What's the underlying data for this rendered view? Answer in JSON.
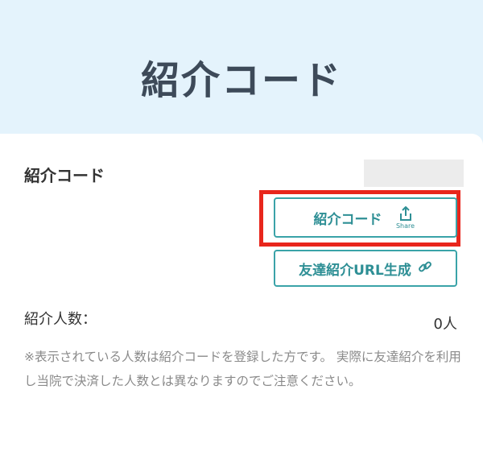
{
  "header": {
    "title": "紹介コード"
  },
  "code_section": {
    "label": "紹介コード",
    "value": ""
  },
  "buttons": {
    "share": {
      "label": "紹介コード",
      "icon": "share-icon",
      "caption": "Share"
    },
    "url": {
      "label": "友達紹介URL生成",
      "icon": "link-icon"
    }
  },
  "stats": {
    "count_label": "紹介人数：",
    "count_value": "0人"
  },
  "notice": "※表示されている人数は紹介コードを登録した方です。 実際に友達紹介を利用し当院で決済した人数とは異なりますのでご注意ください。",
  "colors": {
    "accent": "#3aa3a8",
    "highlight": "#e8261c",
    "header_bg": "#e4f3fc"
  }
}
